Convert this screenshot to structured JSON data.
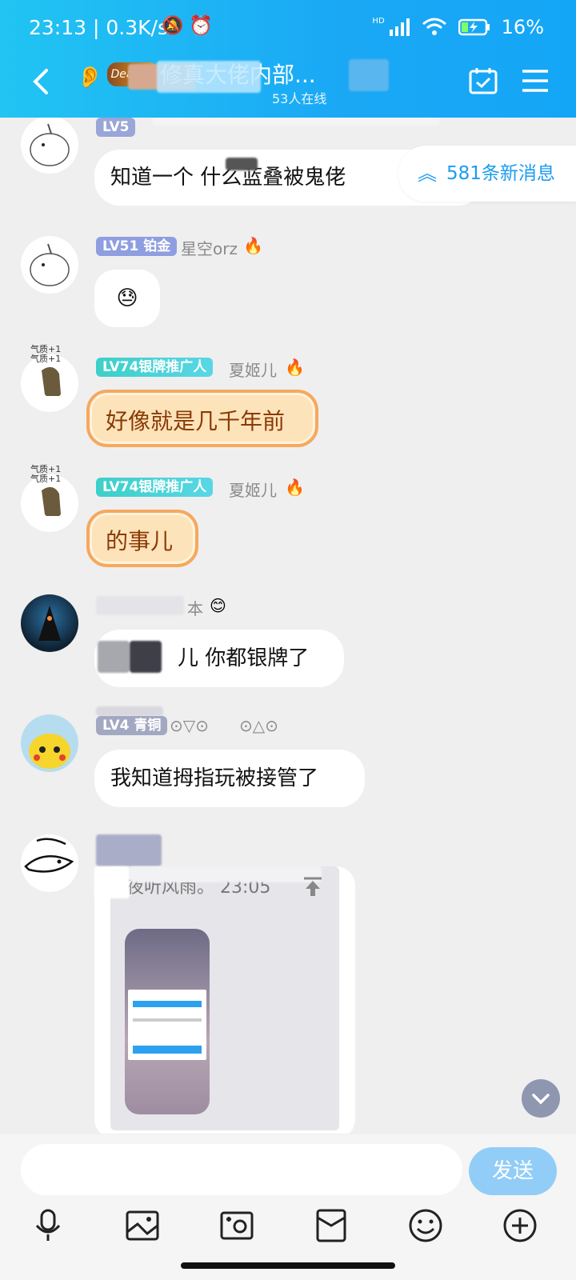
{
  "status": {
    "time_speed": "23:13 | 0.3K/s",
    "network": "HD",
    "battery": "16%"
  },
  "header": {
    "logo_text": "Dearest",
    "title": "修真大佬内部...",
    "subtitle": "53人在线"
  },
  "new_messages": "581条新消息",
  "messages": [
    {
      "level": "LV5",
      "text": "知道一个 什么蓝叠被鬼佬"
    },
    {
      "level": "LV51 铂金",
      "name": "星空orz",
      "text": "😓"
    },
    {
      "level": "LV74银牌推广人",
      "name": "夏姬儿",
      "text": "好像就是几千年前",
      "avatar_text": "气质+1 气质+1"
    },
    {
      "level": "LV74银牌推广人",
      "name": "夏姬儿",
      "text": "的事儿",
      "avatar_text": "气质+1 气质+1"
    },
    {
      "name": "本",
      "text": "儿 你都银牌了"
    },
    {
      "level": "LV4 青铜",
      "name": "⊙▽⊙      ⊙△⊙",
      "text": "我知道拇指玩被接管了"
    },
    {
      "card_text": "夜听风雨。 23:05"
    }
  ],
  "input": {
    "send_label": "发送"
  },
  "colors": {
    "header": "#1aa8f5",
    "accent": "#1a9cf0",
    "send": "#92cdf7"
  }
}
